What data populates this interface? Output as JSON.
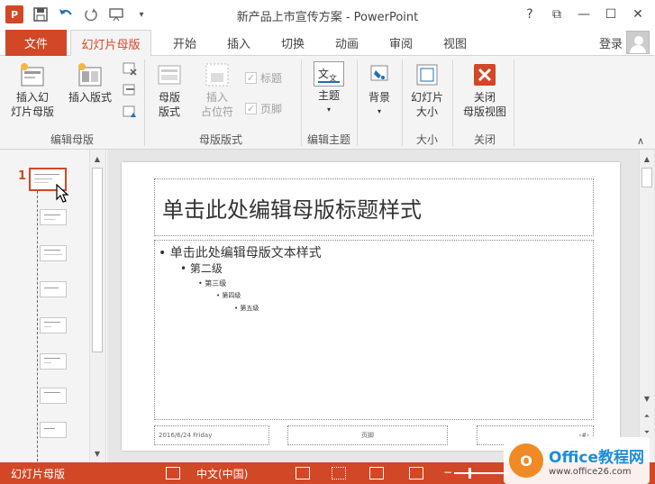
{
  "window": {
    "app_logo": "P",
    "title": "新产品上市宣传方案 - PowerPoint",
    "icons": [
      "save-icon",
      "undo-icon",
      "redo-icon",
      "slideshow-icon",
      "customize-icon"
    ],
    "controls": [
      "?",
      "⧉",
      "—",
      "☐",
      "✕"
    ]
  },
  "tabs": [
    {
      "label": "文件"
    },
    {
      "label": "幻灯片母版"
    },
    {
      "label": "开始"
    },
    {
      "label": "插入"
    },
    {
      "label": "切换"
    },
    {
      "label": "动画"
    },
    {
      "label": "审阅"
    },
    {
      "label": "视图"
    }
  ],
  "account": {
    "login": "登录"
  },
  "ribbon": {
    "insert_master_l1": "插入幻",
    "insert_master_l2": "灯片母版",
    "insert_layout": "插入版式",
    "master_layout_l1": "母版",
    "master_layout_l2": "版式",
    "insert_placeholder_l1": "插入",
    "insert_placeholder_l2": "占位符",
    "chk_title": "标题",
    "chk_footer": "页脚",
    "theme": "主题",
    "background": "背景",
    "slide_size_l1": "幻灯片",
    "slide_size_l2": "大小",
    "close_l1": "关闭",
    "close_l2": "母版视图",
    "groups": {
      "edit_master": "编辑母版",
      "master_layout": "母版版式",
      "edit_theme": "编辑主题",
      "size": "大小",
      "close": "关闭"
    }
  },
  "thumbnails": {
    "first_number": "1",
    "count": 8
  },
  "slide": {
    "title": "单击此处编辑母版标题样式",
    "level1": "单击此处编辑母版文本样式",
    "level2": "第二级",
    "level3": "第三级",
    "level4": "第四级",
    "level5": "第五级",
    "footer_date": "2016/6/24 Friday",
    "footer_text": "页脚",
    "footer_num": "‹#›"
  },
  "status": {
    "view_name": "幻灯片母版",
    "language": "中文(中国)"
  },
  "watermark": {
    "main": "Office教程网",
    "sub": "www.office26.com"
  },
  "colors": {
    "accent": "#d24726"
  }
}
